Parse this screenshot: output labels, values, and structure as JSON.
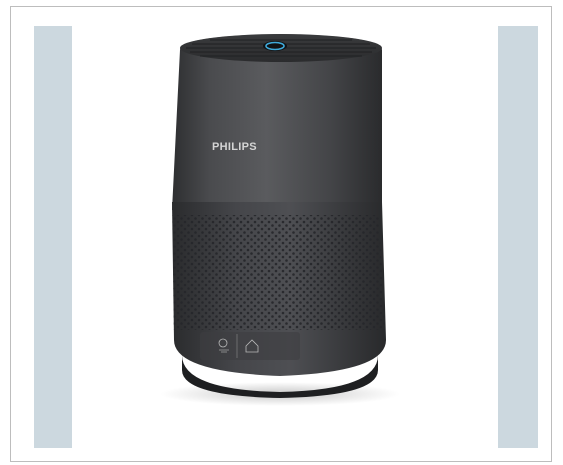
{
  "image": {
    "brand": "PHILIPS",
    "colors": {
      "background": "#ffffff",
      "frame_border": "#bdbdbd",
      "side_panels": "#ccd8df",
      "body_top": "#4a4b4d",
      "body_bottom": "#3f4042",
      "grille_dots": "#2a2b2c",
      "indicator_ring": "#3fa9d9"
    },
    "icons": [
      "air-quality-icon",
      "home-icon"
    ]
  }
}
